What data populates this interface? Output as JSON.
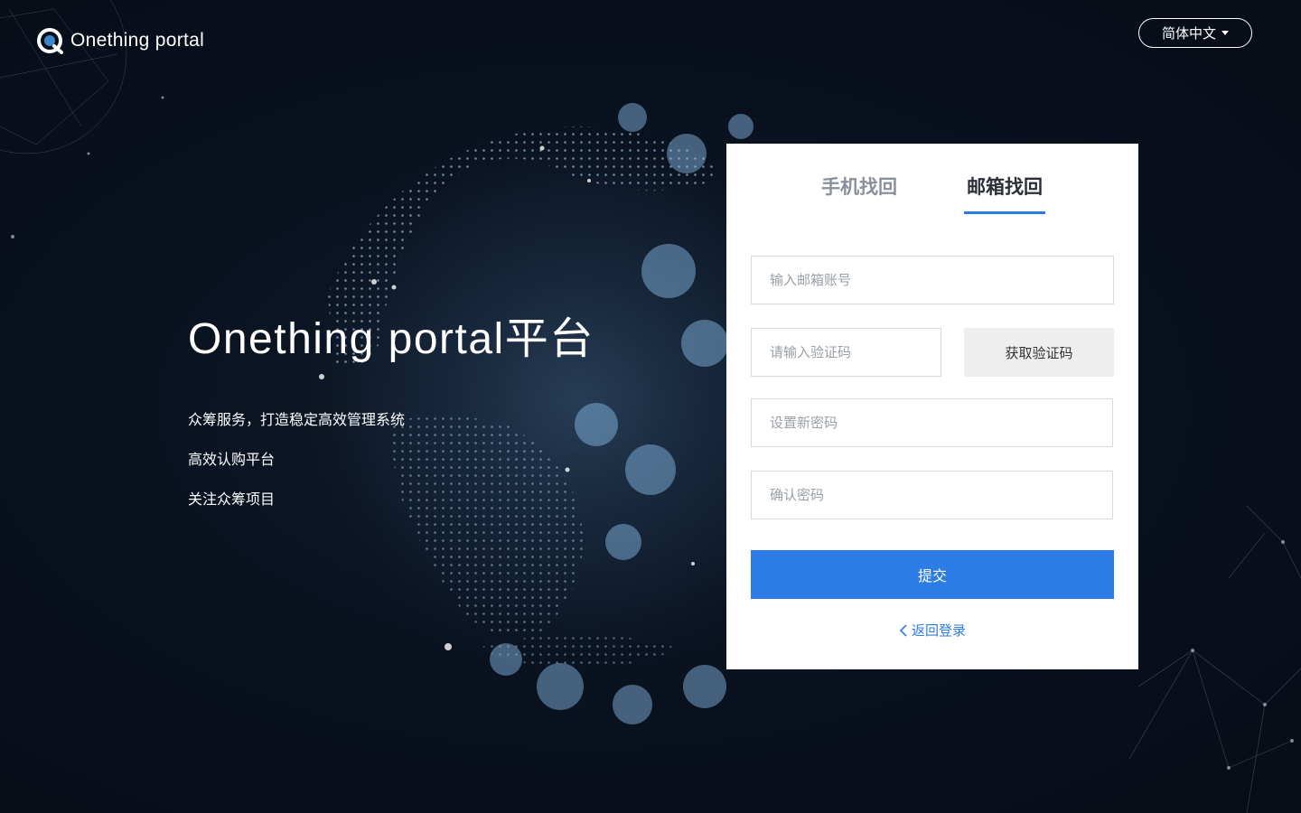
{
  "brand": {
    "name": "Onething portal",
    "logo_icon": "q-logo-icon"
  },
  "language": {
    "current": "简体中文",
    "icon": "caret-down-icon"
  },
  "hero": {
    "title": "Onething portal平台",
    "lines": [
      "众筹服务，打造稳定高效管理系统",
      "高效认购平台",
      "关注众筹项目"
    ]
  },
  "form": {
    "tabs": [
      {
        "label": "手机找回",
        "active": false
      },
      {
        "label": "邮箱找回",
        "active": true
      }
    ],
    "email_placeholder": "输入邮箱账号",
    "code_placeholder": "请输入验证码",
    "get_code_label": "获取验证码",
    "new_password_placeholder": "设置新密码",
    "confirm_password_placeholder": "确认密码",
    "submit_label": "提交",
    "back_label": "返回登录",
    "back_icon": "chevron-left-icon"
  },
  "colors": {
    "accent": "#2d7be5",
    "background": "#0a1220",
    "globe_dots": "#7fb8e8"
  }
}
